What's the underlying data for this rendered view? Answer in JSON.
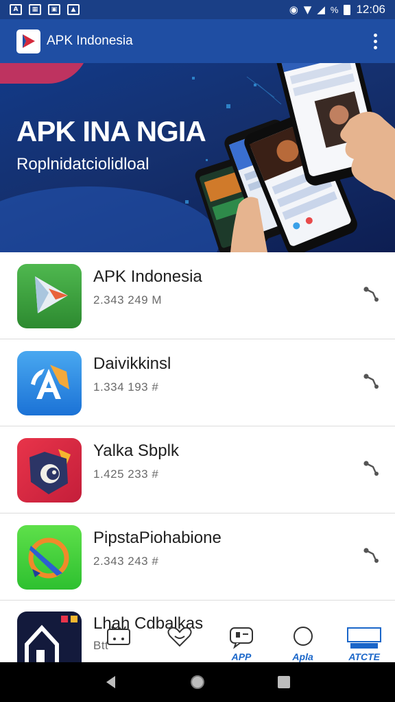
{
  "status_bar": {
    "time": "12:06",
    "battery_text": "%"
  },
  "app_bar": {
    "title": "APK Indonesia"
  },
  "banner": {
    "headline": "APK INA NGIA",
    "subheadline": "Roplnidatciolidloal"
  },
  "apps": [
    {
      "name": "APK Indonesia",
      "meta": "2.343 249 M",
      "icon": "green-arrow-app-icon"
    },
    {
      "name": "Daivikkinsl",
      "meta": "1.334 193 #",
      "icon": "blue-a-app-icon"
    },
    {
      "name": "Yalka Sbplk",
      "meta": "1.425 233 #",
      "icon": "red-mask-app-icon"
    },
    {
      "name": "PipstaPiohabione",
      "meta": "2.343 243 #",
      "icon": "green-brush-app-icon"
    },
    {
      "name": "Lhah Cdbalkas",
      "meta": "Btt",
      "icon": "dark-house-app-icon"
    }
  ],
  "dock": [
    {
      "label": "",
      "icon": "ticket-icon"
    },
    {
      "label": "",
      "icon": "heart-icon"
    },
    {
      "label": "APP",
      "icon": "chat-icon"
    },
    {
      "label": "Apla",
      "icon": "circle-icon"
    },
    {
      "label": "ATCTE",
      "icon": "badge-icon"
    }
  ],
  "colors": {
    "primary": "#1f4ea3",
    "status": "#1a3f86",
    "text": "#202020",
    "meta": "#6a6a6a"
  }
}
